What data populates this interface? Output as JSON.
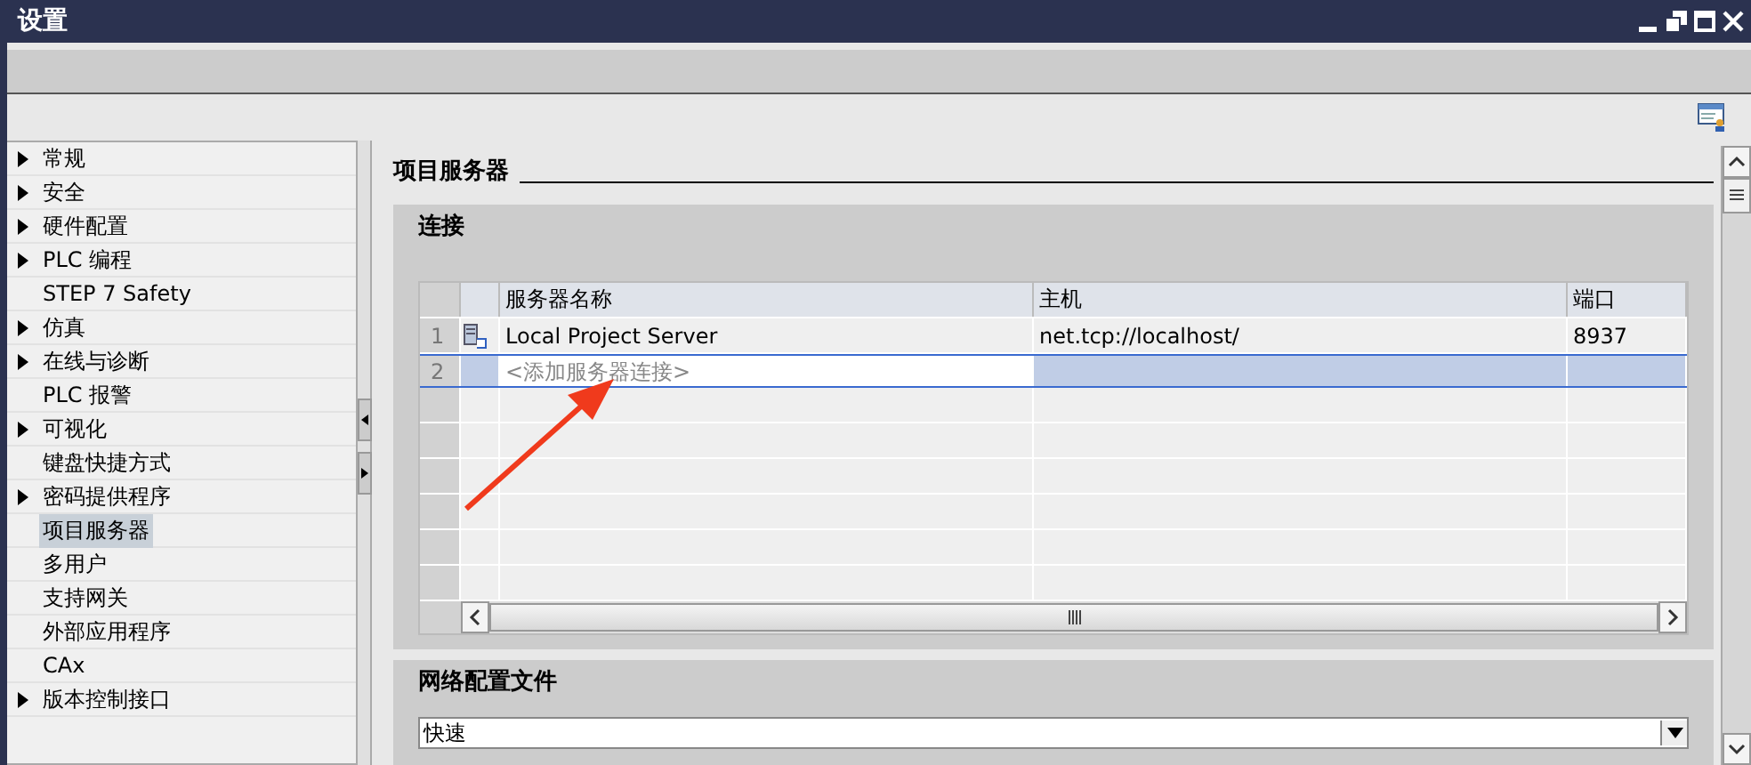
{
  "window": {
    "title": "设置"
  },
  "sidebar": {
    "items": [
      {
        "label": "常规",
        "has_children": true,
        "selected": false
      },
      {
        "label": "安全",
        "has_children": true,
        "selected": false
      },
      {
        "label": "硬件配置",
        "has_children": true,
        "selected": false
      },
      {
        "label": "PLC 编程",
        "has_children": true,
        "selected": false
      },
      {
        "label": "STEP 7 Safety",
        "has_children": false,
        "selected": false
      },
      {
        "label": "仿真",
        "has_children": true,
        "selected": false
      },
      {
        "label": "在线与诊断",
        "has_children": true,
        "selected": false
      },
      {
        "label": "PLC 报警",
        "has_children": false,
        "selected": false
      },
      {
        "label": "可视化",
        "has_children": true,
        "selected": false
      },
      {
        "label": "键盘快捷方式",
        "has_children": false,
        "selected": false
      },
      {
        "label": "密码提供程序",
        "has_children": true,
        "selected": false
      },
      {
        "label": "项目服务器",
        "has_children": false,
        "selected": true
      },
      {
        "label": "多用户",
        "has_children": false,
        "selected": false
      },
      {
        "label": "支持网关",
        "has_children": false,
        "selected": false
      },
      {
        "label": "外部应用程序",
        "has_children": false,
        "selected": false
      },
      {
        "label": "CAx",
        "has_children": false,
        "selected": false
      },
      {
        "label": "版本控制接口",
        "has_children": true,
        "selected": false
      }
    ]
  },
  "page_title": "项目服务器",
  "connections": {
    "title": "连接",
    "columns": [
      "服务器名称",
      "主机",
      "端口"
    ],
    "rows": [
      {
        "number": "1",
        "name": "Local Project Server",
        "host": "net.tcp://localhost/",
        "port": "8937",
        "selected": false
      },
      {
        "number": "2",
        "placeholder": "<添加服务器连接>",
        "selected": true
      }
    ]
  },
  "network_profile": {
    "title": "网络配置文件",
    "value": "快速"
  }
}
